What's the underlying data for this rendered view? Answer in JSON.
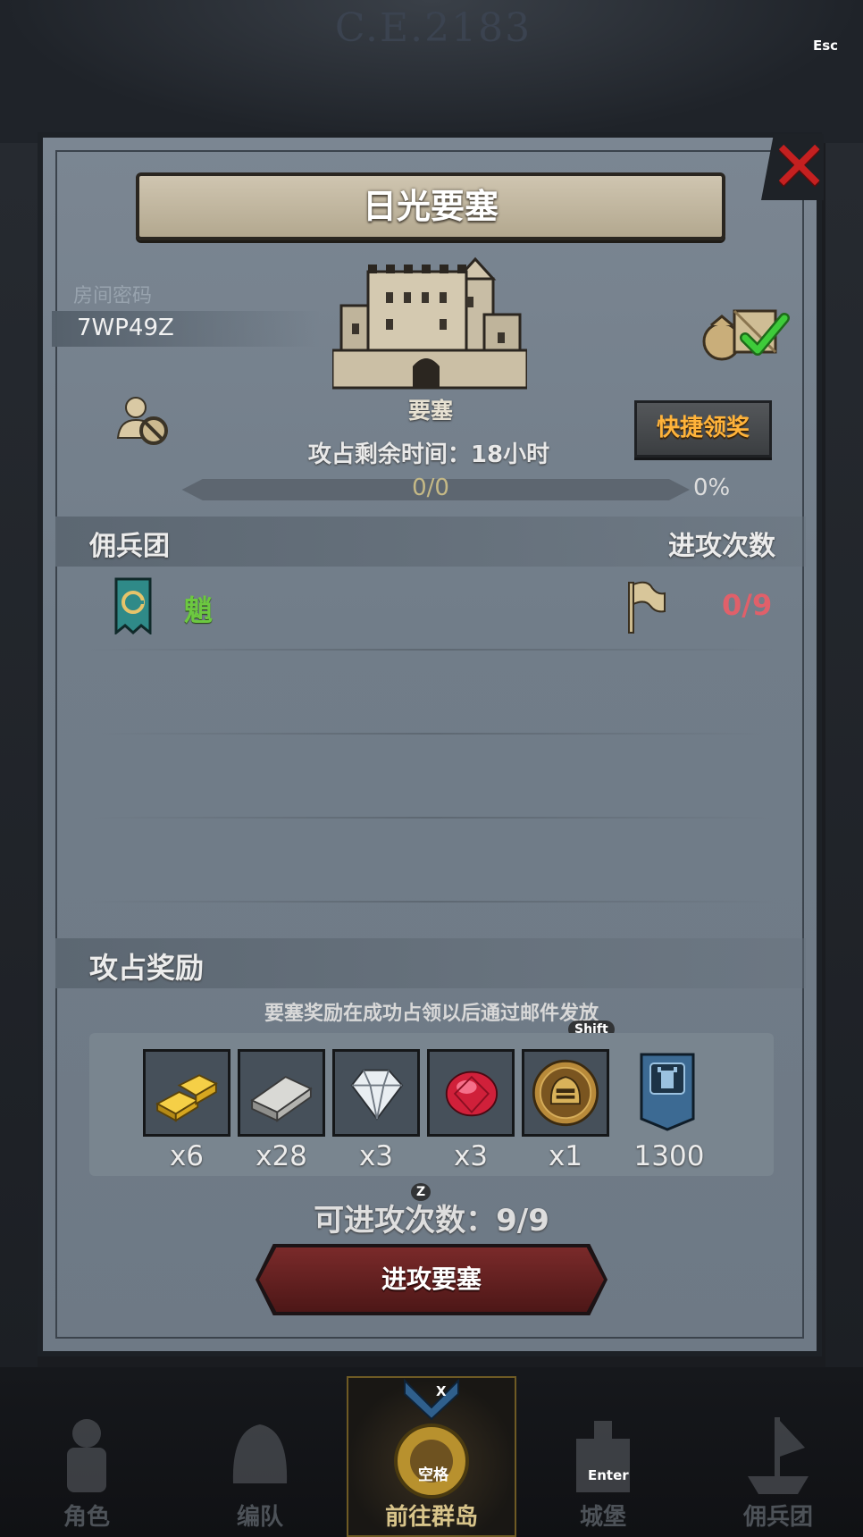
{
  "background": {
    "era_text": "C.E.2183"
  },
  "key_hints": {
    "esc": "Esc",
    "shift": "Shift",
    "z": "Z",
    "x": "X",
    "space": "空格",
    "enter": "Enter"
  },
  "dialog": {
    "title": "日光要塞",
    "room": {
      "label": "房间密码",
      "code": "7WP49Z"
    },
    "fortress_label": "要塞",
    "quick_claim_label": "快捷领奖",
    "remaining_time": "攻占剩余时间：18小时",
    "progress": {
      "count": "0/0",
      "percent": "0%",
      "value": 0
    },
    "mercenary_header": "佣兵团",
    "attacks_header": "进攻次数",
    "guild": {
      "name": "魈",
      "attacks": "0/9"
    },
    "rewards": {
      "title": "攻占奖励",
      "note": "要塞奖励在成功占领以后通过邮件发放",
      "items": [
        {
          "icon": "gold-bars-icon",
          "qty": "x6"
        },
        {
          "icon": "iron-ingot-icon",
          "qty": "x28"
        },
        {
          "icon": "diamond-icon",
          "qty": "x3"
        },
        {
          "icon": "ruby-icon",
          "qty": "x3"
        },
        {
          "icon": "helmet-medal-icon",
          "qty": "x1"
        },
        {
          "icon": "guild-banner-icon",
          "qty": "1300"
        }
      ]
    },
    "can_attack": "可进攻次数：9/9",
    "attack_button": "进攻要塞"
  },
  "bottom_nav": {
    "items": [
      {
        "label": "角色"
      },
      {
        "label": "编队"
      },
      {
        "label": "前往群岛"
      },
      {
        "label": "城堡"
      },
      {
        "label": "佣兵团"
      }
    ]
  },
  "colors": {
    "accent_orange": "#ffb33a",
    "guild_green": "#6cc840",
    "count_red": "#e0606a",
    "attack_btn": "#6a2424",
    "close_red": "#c42020"
  }
}
